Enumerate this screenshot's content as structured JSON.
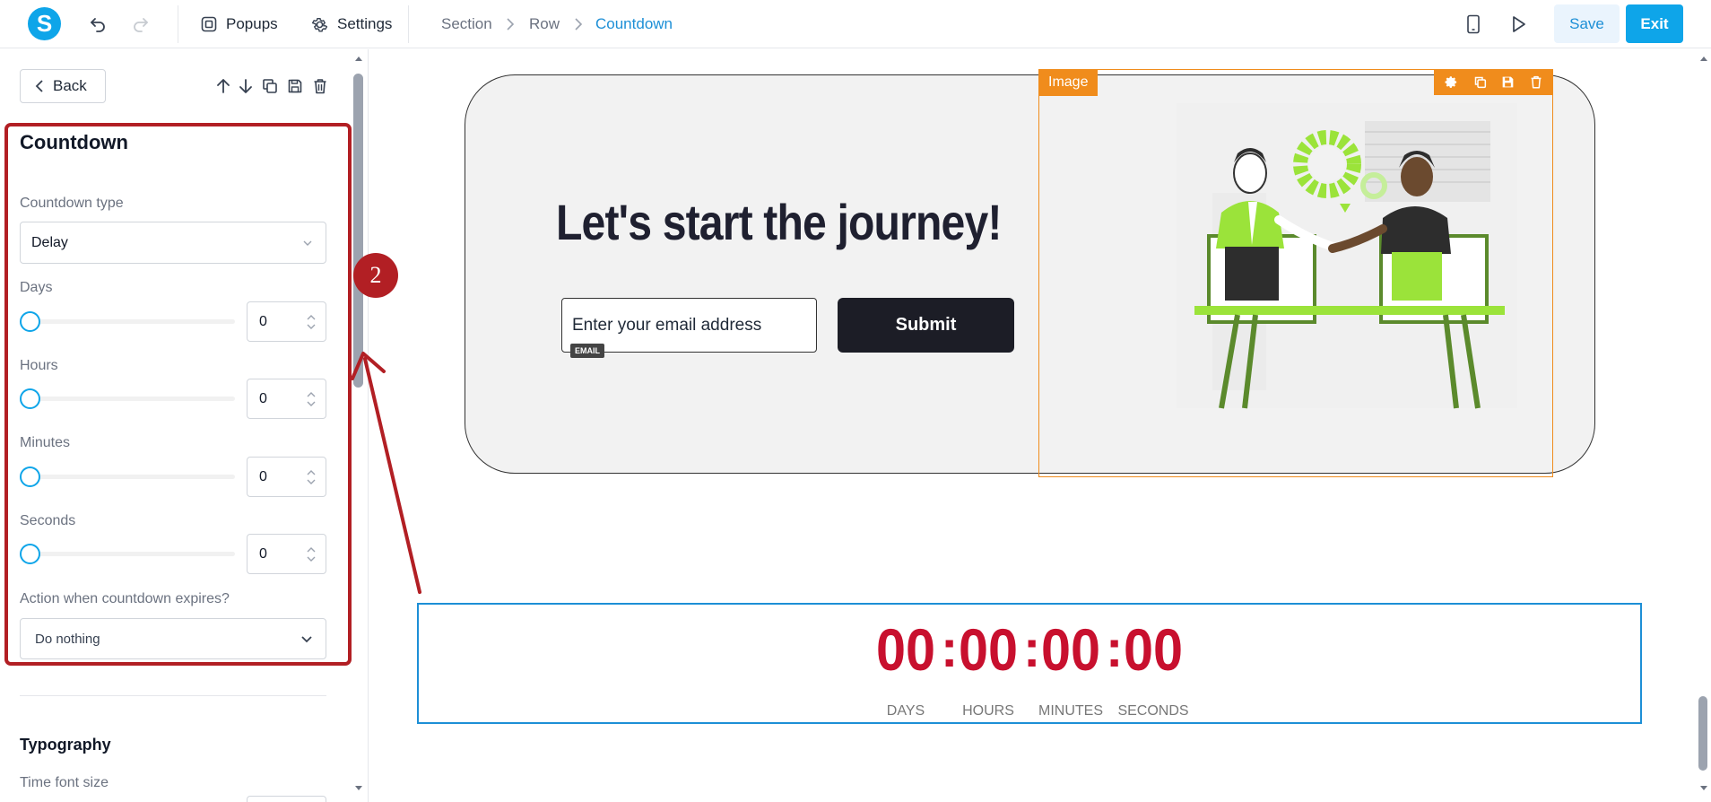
{
  "app": {
    "logo_letter": "S",
    "brand_color": "#0ea5e9",
    "accent_orange": "#f08c1c",
    "annotation_red": "#b21f24"
  },
  "toolbar": {
    "popups_label": "Popups",
    "settings_label": "Settings",
    "save_label": "Save",
    "exit_label": "Exit"
  },
  "breadcrumb": {
    "items": [
      "Section",
      "Row",
      "Countdown"
    ]
  },
  "panel": {
    "back_label": "Back",
    "title": "Countdown",
    "countdown_type_label": "Countdown type",
    "countdown_type_value": "Delay",
    "days_label": "Days",
    "days_value": "0",
    "hours_label": "Hours",
    "hours_value": "0",
    "minutes_label": "Minutes",
    "minutes_value": "0",
    "seconds_label": "Seconds",
    "seconds_value": "0",
    "action_label": "Action when countdown expires?",
    "action_value": "Do nothing",
    "typography_title": "Typography",
    "time_font_size_label": "Time font size"
  },
  "canvas": {
    "hero_title": "Let's start the journey!",
    "email_placeholder": "Enter your email address",
    "email_tag": "EMAIL",
    "submit_label": "Submit",
    "image_tag": "Image",
    "countdown": {
      "days": "00",
      "hours": "00",
      "minutes": "00",
      "seconds": "00",
      "separator": ":",
      "labels": [
        "DAYS",
        "HOURS",
        "MINUTES",
        "SECONDS"
      ],
      "digit_color": "#c8102e"
    }
  },
  "annotation": {
    "step_number": "2"
  }
}
